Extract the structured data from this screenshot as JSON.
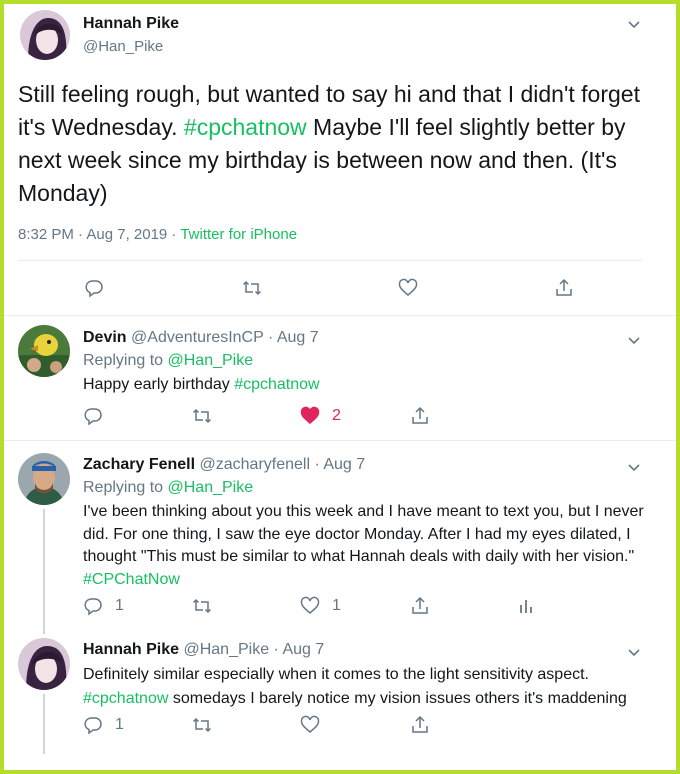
{
  "main_tweet": {
    "name": "Hannah Pike",
    "handle": "@Han_Pike",
    "text_1": "Still feeling rough, but wanted to say hi and that I didn't forget it's Wednesday. ",
    "hashtag": "#cpchatnow",
    "text_2": " Maybe I'll feel slightly better by next week since my birthday is between now and then. (It's Monday)",
    "time": "8:32 PM · Aug 7, 2019 · ",
    "source": "Twitter for iPhone"
  },
  "replies": [
    {
      "name": "Devin",
      "handle": "@AdventuresInCP",
      "date": " · Aug 7",
      "replying_label": "Replying to ",
      "replying_to": "@Han_Pike",
      "text": "Happy early birthday ",
      "hashtag": "#cpchatnow",
      "like_count": "2"
    },
    {
      "name": "Zachary Fenell",
      "handle": "@zacharyfenell",
      "date": " · Aug 7",
      "replying_label": "Replying to ",
      "replying_to": "@Han_Pike",
      "text": "I've been thinking about you this week and I have meant to text you, but I never did. For one thing, I saw the eye doctor Monday. After I had my eyes dilated, I thought \"This must be similar to what Hannah deals with daily with her vision.\" ",
      "hashtag": "#CPChatNow",
      "reply_count": "1",
      "like_count": "1"
    },
    {
      "name": "Hannah Pike",
      "handle": "@Han_Pike",
      "date": " · Aug 7",
      "text_1": "Definitely similar especially when it comes to the light sensitivity aspect. ",
      "hashtag": "#cpchatnow",
      "text_2": " somedays I barely notice my vision issues others it's maddening",
      "reply_count": "1"
    }
  ],
  "colors": {
    "border": "#b5dd2b",
    "link": "#17bf63",
    "like": "#e0245e",
    "muted": "#657786"
  },
  "icons": [
    "reply-icon",
    "retweet-icon",
    "like-icon",
    "share-icon",
    "analytics-icon",
    "chevron-down-icon"
  ]
}
